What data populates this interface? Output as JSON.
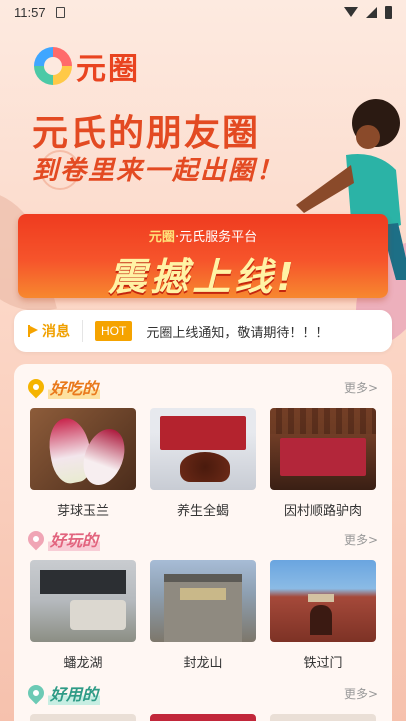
{
  "status_bar": {
    "time": "11:57"
  },
  "logo": {
    "text": "元圈"
  },
  "hero": {
    "title": "元氏的朋友圈",
    "subtitle": "到卷里来一起出圈！"
  },
  "banner": {
    "brand": "元圈",
    "tagline": "·元氏服务平台",
    "main": "震撼上线!"
  },
  "notice": {
    "label": "消息",
    "badge": "HOT",
    "text": "元圈上线通知，敬请期待！！！"
  },
  "sections": [
    {
      "title": "好吃的",
      "more": "更多>",
      "items": [
        {
          "label": "芽球玉兰"
        },
        {
          "label": "养生全蝎"
        },
        {
          "label": "因村顺路驴肉"
        }
      ]
    },
    {
      "title": "好玩的",
      "more": "更多>",
      "items": [
        {
          "label": "蟠龙湖"
        },
        {
          "label": "封龙山"
        },
        {
          "label": "铁过门"
        }
      ]
    },
    {
      "title": "好用的",
      "more": "更多>"
    }
  ],
  "colors": {
    "accent": "#e34a22",
    "notice": "#f5a300",
    "banner": "#ef3b1f"
  }
}
